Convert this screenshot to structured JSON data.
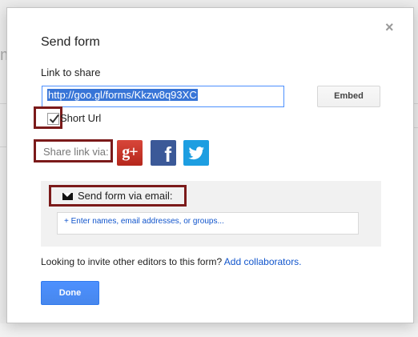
{
  "backdrop": {
    "left_text": "m"
  },
  "dialog": {
    "title": "Send form",
    "close_glyph": "×",
    "link": {
      "label": "Link to share",
      "value": "http://goo.gl/forms/Kkzw8q93XC",
      "embed_label": "Embed"
    },
    "short_url": {
      "label": "Short Url",
      "checked": true
    },
    "share": {
      "label": "Share link via:",
      "networks": [
        {
          "name": "Google+",
          "icon": "google-plus-icon",
          "glyph": "g+",
          "color": "#c5392c"
        },
        {
          "name": "Facebook",
          "icon": "facebook-icon",
          "glyph": "f",
          "color": "#3b5998"
        },
        {
          "name": "Twitter",
          "icon": "twitter-icon",
          "color": "#1d9ee1"
        }
      ]
    },
    "email": {
      "label": "Send form via email:",
      "placeholder": "+ Enter names, email addresses, or groups..."
    },
    "invite": {
      "text": "Looking to invite other editors to this form?",
      "link": "Add collaborators."
    },
    "done_label": "Done"
  },
  "colors": {
    "highlight": "#7b1a1a",
    "primary_blue": "#4d90fe",
    "link_blue": "#1155cc"
  }
}
